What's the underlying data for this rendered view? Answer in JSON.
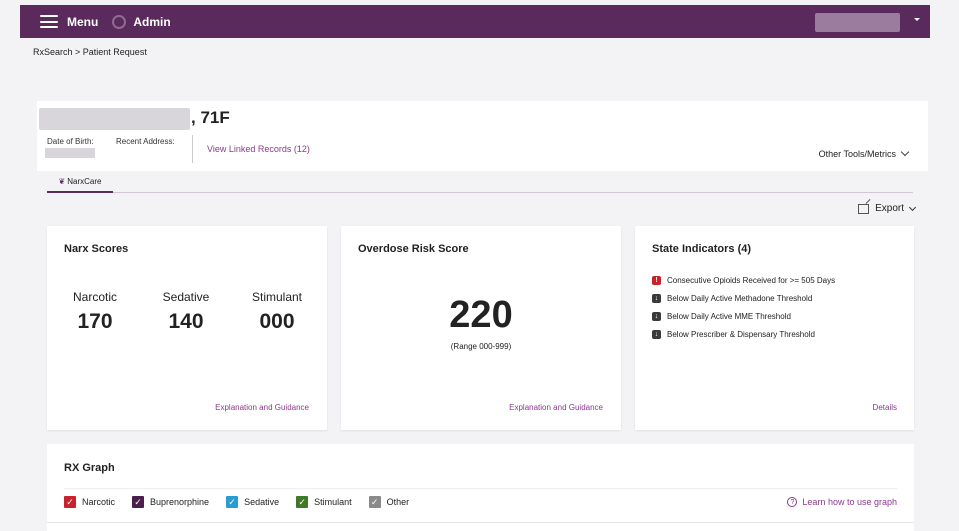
{
  "topbar": {
    "menu_label": "Menu",
    "admin_label": "Admin",
    "bg_color": "#5a2a5c"
  },
  "breadcrumb": "RxSearch > Patient Request",
  "patient": {
    "age_sex": ", 71F",
    "dob_label": "Date of Birth:",
    "address_label": "Recent Address:",
    "linked_records": "View Linked Records (12)",
    "other_tools": "Other Tools/Metrics"
  },
  "tabs": [
    {
      "label": "NarxCare",
      "logo": "❦",
      "active": true
    }
  ],
  "export_label": "Export",
  "narx": {
    "title": "Narx Scores",
    "scores": [
      {
        "label": "Narcotic",
        "value": "170"
      },
      {
        "label": "Sedative",
        "value": "140"
      },
      {
        "label": "Stimulant",
        "value": "000"
      }
    ],
    "link": "Explanation and Guidance"
  },
  "overdose": {
    "title": "Overdose Risk Score",
    "value": "220",
    "range": "(Range 000-999)",
    "link": "Explanation and Guidance"
  },
  "state": {
    "title": "State Indicators (4)",
    "indicators": [
      {
        "text": "Consecutive Opioids Received for >= 505 Days",
        "icon": "!"
      },
      {
        "text": "Below Daily Active Methadone Threshold",
        "icon": "↓"
      },
      {
        "text": "Below Daily Active MME Threshold",
        "icon": "↓"
      },
      {
        "text": "Below Prescriber & Dispensary Threshold",
        "icon": "↓"
      }
    ],
    "link": "Details"
  },
  "rx_graph": {
    "title": "RX Graph",
    "legend": [
      {
        "label": "Narcotic",
        "color": "#c8232b"
      },
      {
        "label": "Buprenorphine",
        "color": "#4a1f4c"
      },
      {
        "label": "Sedative",
        "color": "#2a9cd0"
      },
      {
        "label": "Stimulant",
        "color": "#3e7a2a"
      },
      {
        "label": "Other",
        "color": "#8a8a8a"
      }
    ],
    "learn_link": "Learn how to use graph"
  },
  "colors": {
    "accent": "#8a3a8e",
    "alert_red": "#c8232b"
  }
}
